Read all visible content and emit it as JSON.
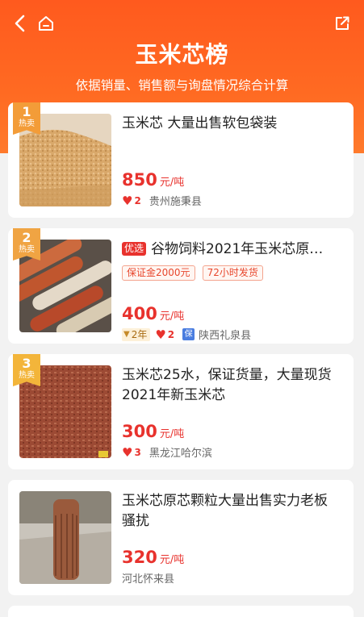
{
  "header": {
    "title": "玉米芯榜",
    "subtitle": "依据销量、销售额与询盘情况综合计算"
  },
  "colors": {
    "header": "#ff6a22",
    "accent": "#e8322d",
    "badge": "#f5a623"
  },
  "icons": {
    "back": "chevron-left-icon",
    "home": "home-icon",
    "share": "share-icon",
    "heart": "heart-icon"
  },
  "items": [
    {
      "rank": "1",
      "hot": "热卖",
      "title": "玉米芯 大量出售软包袋装",
      "price": "850",
      "unit": "元/吨",
      "likes": "2",
      "location": "贵州施秉县"
    },
    {
      "rank": "2",
      "hot": "热卖",
      "badge": "优选",
      "title": "谷物饲料2021年玉米芯原…",
      "tags": [
        "保证金2000元",
        "72小时发货"
      ],
      "price": "400",
      "unit": "元/吨",
      "years": "2年",
      "likes": "2",
      "bao": "保",
      "location": "陕西礼泉县"
    },
    {
      "rank": "3",
      "hot": "热卖",
      "title": "玉米芯25水，保证货量，大量现货2021年新玉米芯",
      "price": "300",
      "unit": "元/吨",
      "likes": "3",
      "location": "黑龙江哈尔滨"
    },
    {
      "title": "玉米芯原芯颗粒大量出售实力老板骚扰",
      "price": "320",
      "unit": "元/吨",
      "location": "河北怀来县"
    }
  ]
}
